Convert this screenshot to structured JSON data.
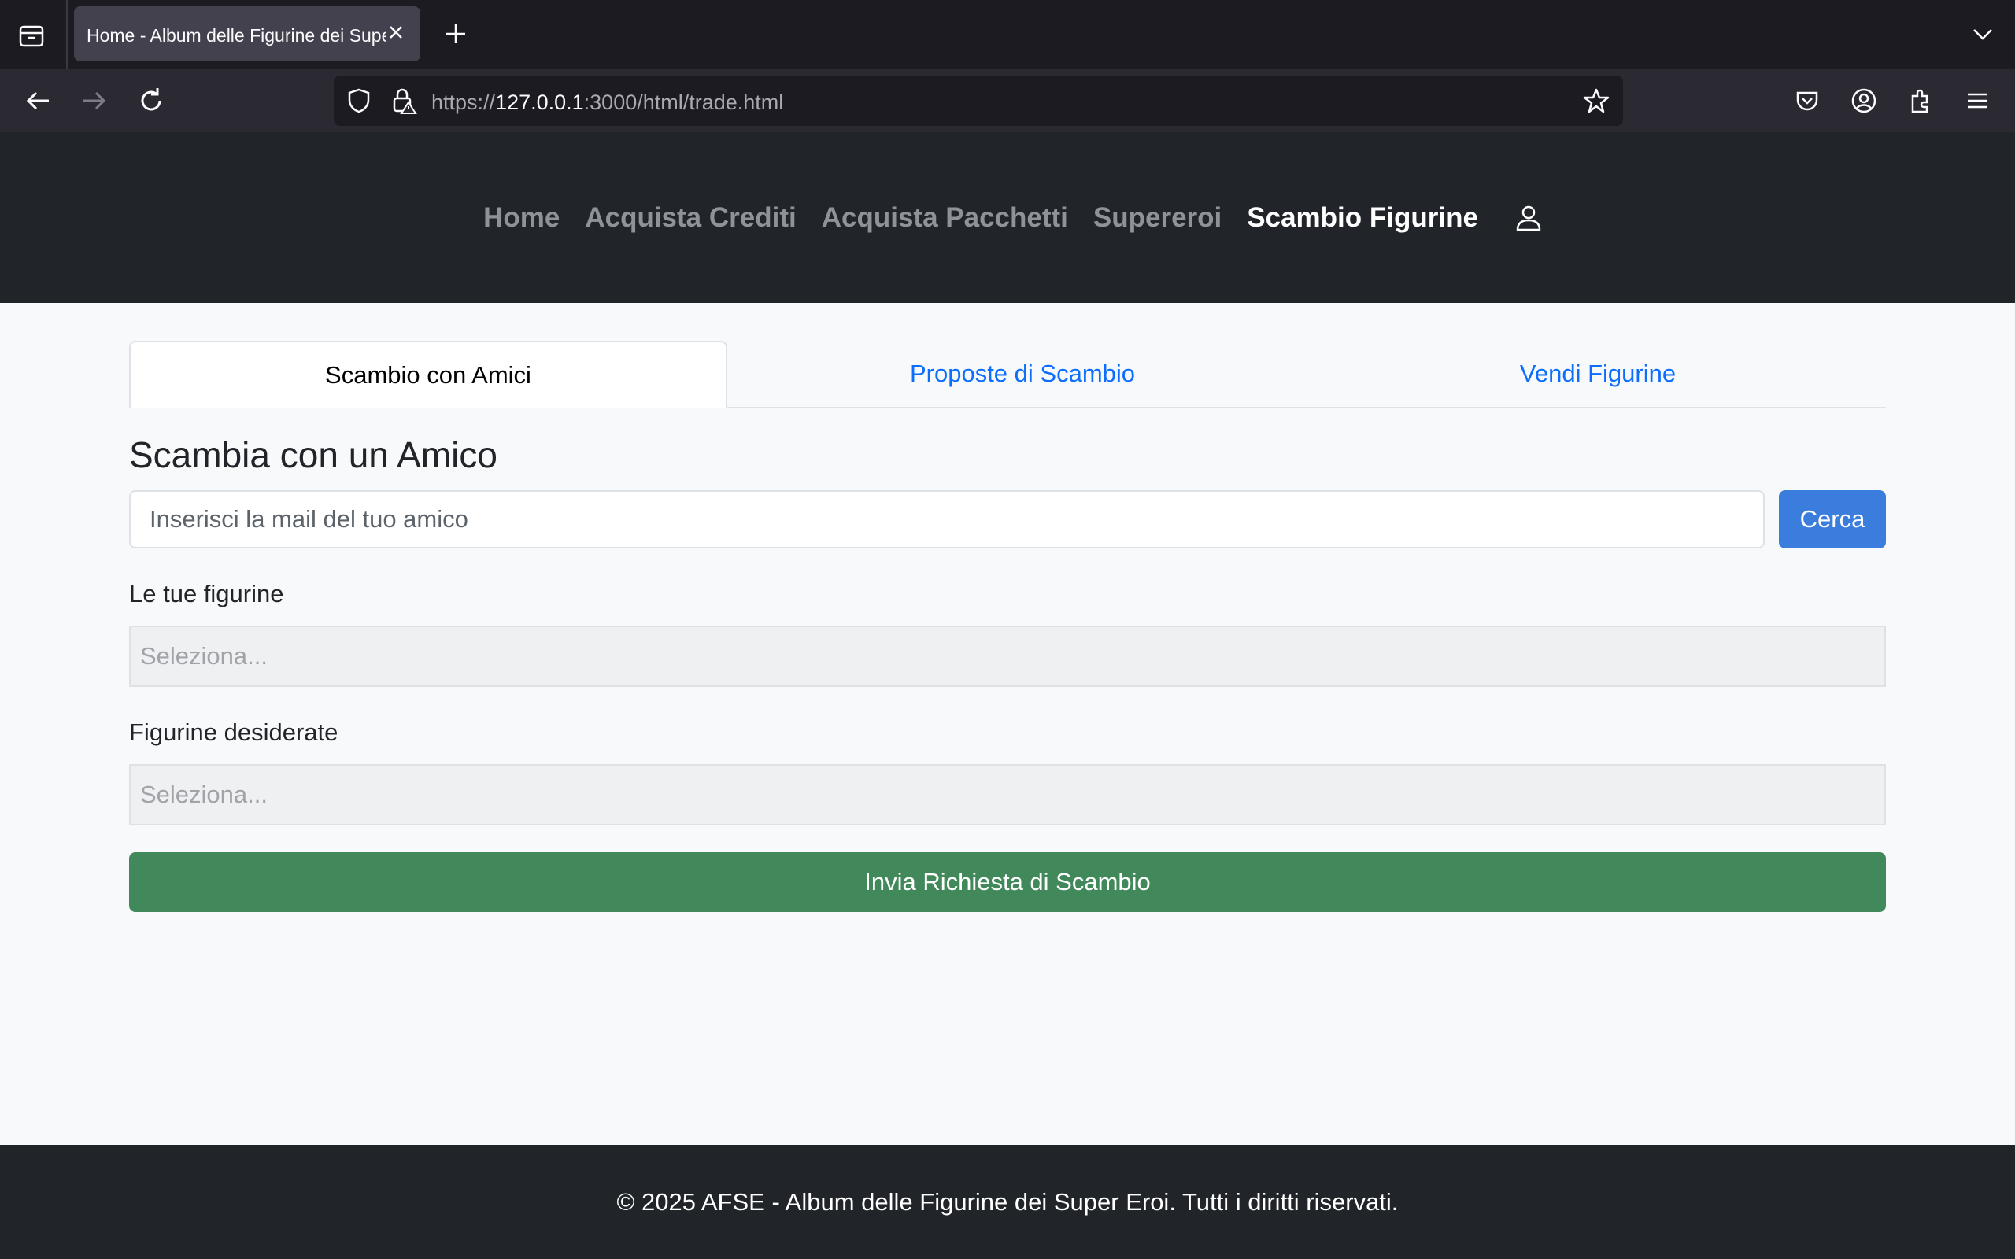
{
  "browser": {
    "tab_title": "Home - Album delle Figurine dei Super Eroi",
    "url_scheme": "https://",
    "url_host": "127.0.0.1",
    "url_rest": ":3000/html/trade.html"
  },
  "header": {
    "menu": [
      {
        "label": "Home",
        "active": false
      },
      {
        "label": "Acquista Crediti",
        "active": false
      },
      {
        "label": "Acquista Pacchetti",
        "active": false
      },
      {
        "label": "Supereroi",
        "active": false
      },
      {
        "label": "Scambio Figurine",
        "active": true
      }
    ],
    "user_icon": "user-icon"
  },
  "tabs": [
    {
      "label": "Scambio con Amici",
      "active": true
    },
    {
      "label": "Proposte di Scambio",
      "active": false
    },
    {
      "label": "Vendi Figurine",
      "active": false
    }
  ],
  "trade_form": {
    "title": "Scambia con un Amico",
    "email_placeholder": "Inserisci la mail del tuo amico",
    "search_label": "Cerca",
    "my_cards_label": "Le tue figurine",
    "my_cards_placeholder": "Seleziona...",
    "wanted_cards_label": "Figurine desiderate",
    "wanted_cards_placeholder": "Seleziona...",
    "submit_label": "Invia Richiesta di Scambio"
  },
  "footer": {
    "text": "© 2025 AFSE - Album delle Figurine dei Super Eroi. Tutti i diritti riservati."
  },
  "colors": {
    "header_bg": "#212529",
    "primary": "#3b7ddd",
    "success": "#41895a",
    "link": "#0d6efd"
  }
}
